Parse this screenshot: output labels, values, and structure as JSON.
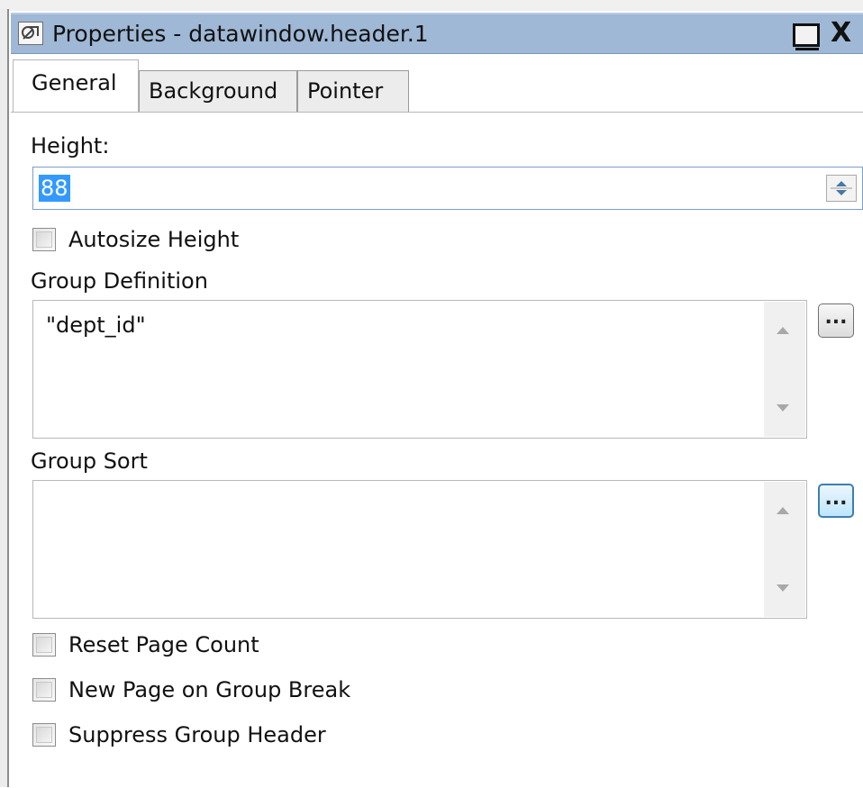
{
  "window": {
    "title": "Properties - datawindow.header.1",
    "maximize_icon": "maximize-icon",
    "close_label": "X"
  },
  "tabs": [
    {
      "label": "General",
      "active": true
    },
    {
      "label": "Background",
      "active": false
    },
    {
      "label": "Pointer",
      "active": false
    }
  ],
  "general": {
    "height_label": "Height:",
    "height_value": "88",
    "autosize_label": "Autosize Height",
    "autosize_checked": false,
    "group_definition_label": "Group Definition",
    "group_definition_value": "\"dept_id\"",
    "group_sort_label": "Group Sort",
    "group_sort_value": "",
    "ellipsis_label": "...",
    "reset_page_count_label": "Reset Page Count",
    "reset_page_count_checked": false,
    "new_page_label": "New Page on Group Break",
    "new_page_checked": false,
    "suppress_header_label": "Suppress Group Header",
    "suppress_header_checked": false
  },
  "colors": {
    "titlebar": "#9fb8d6",
    "selection": "#3399ff",
    "focus_border": "#3c7fb1"
  }
}
